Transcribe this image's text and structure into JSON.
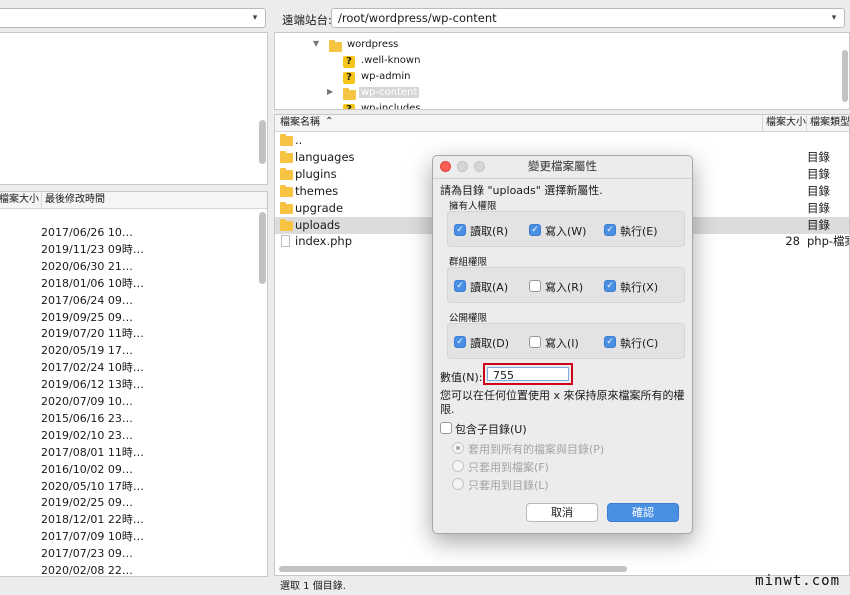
{
  "left": {
    "col_size": "檔案大小",
    "col_modified": "最後修改時間",
    "dates": [
      "2017/06/26 10…",
      "2019/11/23 09時…",
      "2020/06/30 21…",
      "2018/01/06 10時…",
      "2017/06/24 09…",
      "2019/09/25 09…",
      "2019/07/20 11時…",
      "2020/05/19 17…",
      "2017/02/24 10時…",
      "2019/06/12 13時…",
      "2020/07/09 10…",
      "2015/06/16 23…",
      "2019/02/10 23…",
      "2017/08/01 11時…",
      "2016/10/02 09…",
      "2020/05/10 17時…",
      "2019/02/25 09…",
      "2018/12/01 22時…",
      "2017/07/09 10時…",
      "2017/07/23 09…",
      "2020/02/08 22…"
    ]
  },
  "remote": {
    "label": "遠端站台:",
    "path": "/root/wordpress/wp-content",
    "tree": [
      {
        "name": "wordpress",
        "type": "folder",
        "expanded": true
      },
      {
        "name": ".well-known",
        "type": "unknown"
      },
      {
        "name": "wp-admin",
        "type": "unknown"
      },
      {
        "name": "wp-content",
        "type": "folder",
        "selected": true
      },
      {
        "name": "wp-includes",
        "type": "unknown"
      }
    ],
    "col_name": "檔案名稱",
    "col_size": "檔案大小",
    "col_type": "檔案類型",
    "files": [
      {
        "name": "..",
        "size": "",
        "type": "",
        "kind": "folder"
      },
      {
        "name": "languages",
        "size": "",
        "type": "目錄",
        "kind": "folder"
      },
      {
        "name": "plugins",
        "size": "",
        "type": "目錄",
        "kind": "folder"
      },
      {
        "name": "themes",
        "size": "",
        "type": "目錄",
        "kind": "folder"
      },
      {
        "name": "upgrade",
        "size": "",
        "type": "目錄",
        "kind": "folder"
      },
      {
        "name": "uploads",
        "size": "",
        "type": "目錄",
        "kind": "folder",
        "selected": true
      },
      {
        "name": "index.php",
        "size": "28",
        "type": "php-檔案",
        "kind": "file"
      }
    ],
    "status": "選取 1 個目錄."
  },
  "dialog": {
    "title": "變更檔案屬性",
    "intro": "請為目錄 \"uploads\" 選擇新屬性.",
    "owner": {
      "title": "擁有人權限",
      "read": "讀取(R)",
      "write": "寫入(W)",
      "exec": "執行(E)"
    },
    "group": {
      "title": "群組權限",
      "read": "讀取(A)",
      "write": "寫入(R)",
      "exec": "執行(X)"
    },
    "public": {
      "title": "公開權限",
      "read": "讀取(D)",
      "write": "寫入(I)",
      "exec": "執行(C)"
    },
    "value_label": "數值(N):",
    "value": "755",
    "hint": "您可以在任何位置使用 x 來保持原來檔案所有的權限.",
    "recurse_label": "包含子目錄(U)",
    "radio_all": "套用到所有的檔案與目錄(P)",
    "radio_files": "只套用到檔案(F)",
    "radio_dirs": "只套用到目錄(L)",
    "cancel": "取消",
    "ok": "確認"
  },
  "watermark": "minwt.com",
  "colors": {
    "accent": "#4a90e2",
    "highlight": "#d0021b",
    "selected_row": "#dcdcdc",
    "folder": "#f6c343"
  }
}
